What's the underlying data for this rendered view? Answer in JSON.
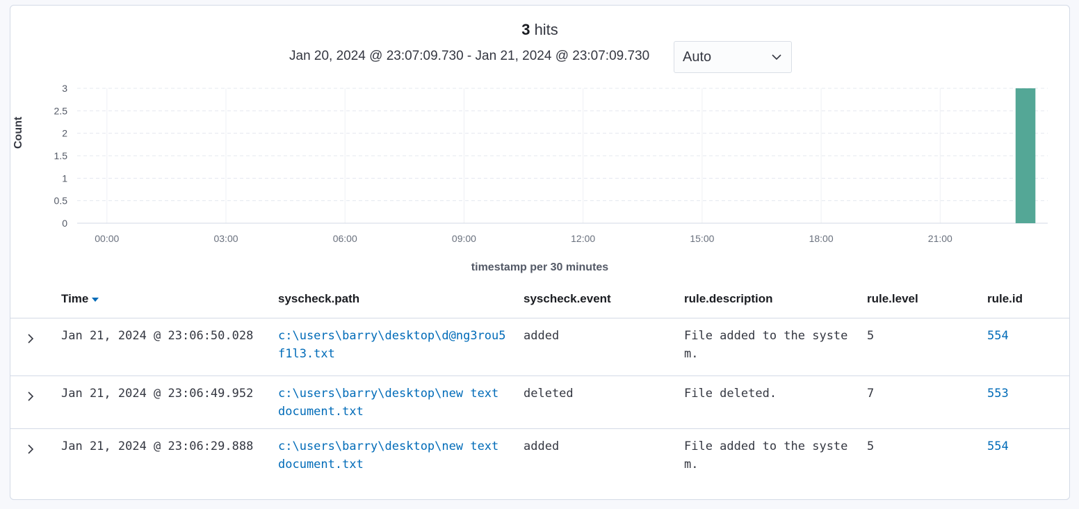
{
  "summary": {
    "hits_count": "3",
    "hits_label": "hits",
    "time_range": "Jan 20, 2024 @ 23:07:09.730 - Jan 21, 2024 @ 23:07:09.730",
    "interval_value": "Auto"
  },
  "chart_data": {
    "type": "bar",
    "xlabel": "timestamp per 30 minutes",
    "ylabel": "Count",
    "ylim": [
      0,
      3
    ],
    "yticks": [
      "0",
      "0.5",
      "1",
      "1.5",
      "2",
      "2.5",
      "3"
    ],
    "xticks": [
      "00:00",
      "03:00",
      "06:00",
      "09:00",
      "12:00",
      "15:00",
      "18:00",
      "21:00"
    ],
    "x_range_hours": [
      -0.75,
      23.71
    ],
    "bars": [
      {
        "start_hour": 22.9,
        "end_hour": 23.4,
        "count": 3
      }
    ],
    "grid": true,
    "bar_color": "#54a796"
  },
  "table": {
    "columns": [
      "Time",
      "syscheck.path",
      "syscheck.event",
      "rule.description",
      "rule.level",
      "rule.id"
    ],
    "rows": [
      {
        "time": "Jan 21, 2024 @ 23:06:50.028",
        "path": "c:\\users\\barry\\desktop\\d@ng3rou5f1l3.txt",
        "event": "added",
        "description": "File added to the system.",
        "level": "5",
        "rule_id": "554"
      },
      {
        "time": "Jan 21, 2024 @ 23:06:49.952",
        "path": "c:\\users\\barry\\desktop\\new text document.txt",
        "event": "deleted",
        "description": "File deleted.",
        "level": "7",
        "rule_id": "553"
      },
      {
        "time": "Jan 21, 2024 @ 23:06:29.888",
        "path": "c:\\users\\barry\\desktop\\new text document.txt",
        "event": "added",
        "description": "File added to the system.",
        "level": "5",
        "rule_id": "554"
      }
    ]
  }
}
